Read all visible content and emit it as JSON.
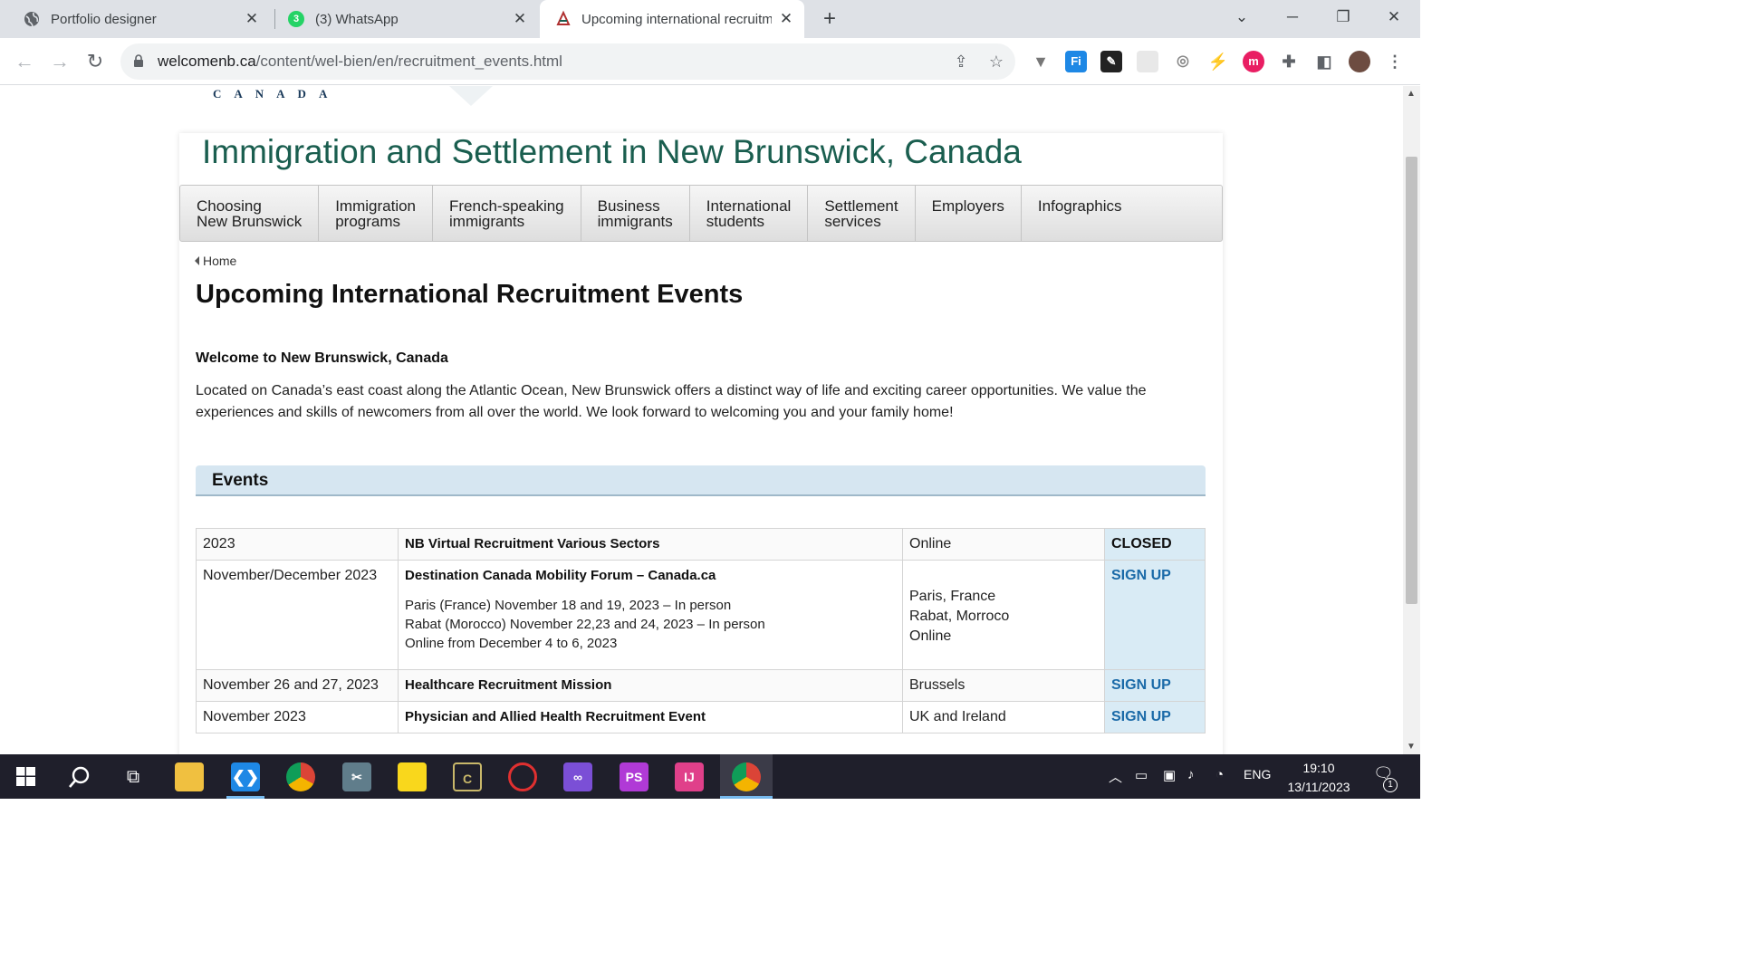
{
  "browser": {
    "tabs": [
      {
        "title": "Portfolio designer",
        "icon": "globe-icon"
      },
      {
        "title": "(3) WhatsApp",
        "icon": "whatsapp-icon",
        "badge": "3"
      },
      {
        "title": "Upcoming international recruitm",
        "icon": "nb-site-icon"
      }
    ],
    "new_tab": "+",
    "url_host": "welcomenb.ca",
    "url_path": "/content/wel-bien/en/recruitment_events.html"
  },
  "site": {
    "logo_text": "CANADA",
    "title": "Immigration and Settlement in New Brunswick, Canada",
    "nav": [
      {
        "line1": "Choosing",
        "line2": "New Brunswick"
      },
      {
        "line1": "Immigration",
        "line2": "programs"
      },
      {
        "line1": "French-speaking",
        "line2": "immigrants"
      },
      {
        "line1": "Business",
        "line2": "immigrants"
      },
      {
        "line1": "International",
        "line2": "students"
      },
      {
        "line1": "Settlement",
        "line2": "services"
      },
      {
        "line1": "Employers",
        "line2": ""
      },
      {
        "line1": "Infographics",
        "line2": ""
      }
    ]
  },
  "content": {
    "breadcrumb": "Home",
    "page_title": "Upcoming International Recruitment Events",
    "welcome_heading": "Welcome to New Brunswick, Canada",
    "intro": "Located on Canada’s east coast along the Atlantic Ocean, New Brunswick offers a distinct way of life and exciting career opportunities. We value the experiences and skills of newcomers from all over the world. We look forward to welcoming you and your family home!",
    "events_heading": "Events",
    "events": [
      {
        "date": "2023",
        "name": "NB Virtual Recruitment Various Sectors",
        "details": [],
        "locations": [
          "Online"
        ],
        "status": "CLOSED"
      },
      {
        "date": "November/December 2023",
        "name": "Destination Canada Mobility Forum – Canada.ca",
        "details": [
          "Paris (France) November 18 and 19, 2023 – In person",
          "Rabat (Morocco) November 22,23 and 24, 2023 – In person",
          "Online from December 4 to 6, 2023"
        ],
        "locations": [
          "Paris, France",
          "Rabat, Morroco",
          "Online"
        ],
        "status": "SIGN UP"
      },
      {
        "date": "November 26 and 27, 2023",
        "name": "Healthcare Recruitment Mission",
        "details": [],
        "locations": [
          "Brussels"
        ],
        "status": "SIGN UP"
      },
      {
        "date": "November 2023",
        "name": "Physician and Allied Health Recruitment Event",
        "details": [],
        "locations": [
          "UK and Ireland"
        ],
        "status": "SIGN UP"
      }
    ]
  },
  "taskbar": {
    "language": "ENG",
    "time": "19:10",
    "date": "13/11/2023",
    "notification_count": "1"
  }
}
